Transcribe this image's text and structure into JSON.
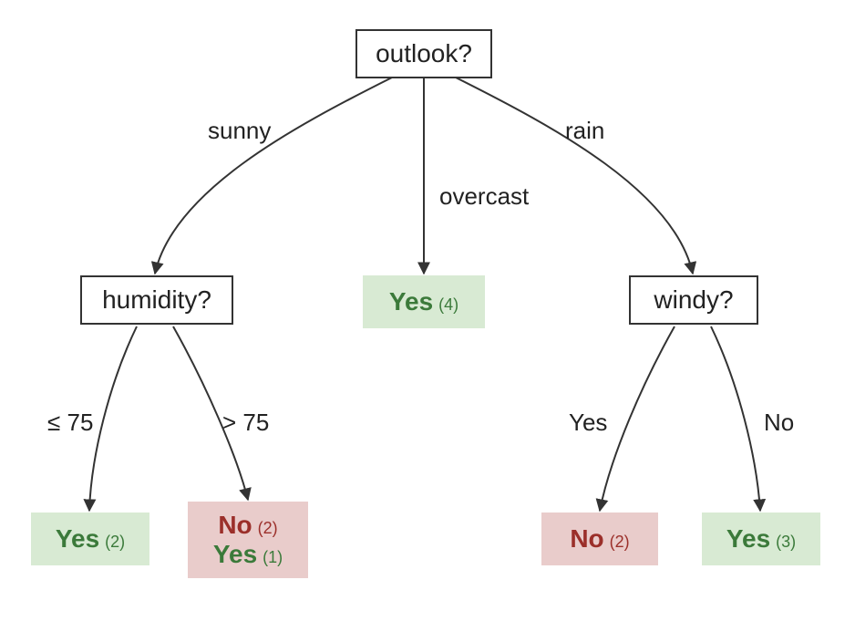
{
  "diagram": {
    "type": "decision-tree",
    "root": {
      "label": "outlook?",
      "branches": {
        "sunny": {
          "label": "sunny"
        },
        "overcast": {
          "label": "overcast"
        },
        "rain": {
          "label": "rain"
        }
      }
    },
    "humidity": {
      "label": "humidity?",
      "branches": {
        "le75": {
          "label": "≤ 75"
        },
        "gt75": {
          "label": "> 75"
        }
      }
    },
    "windy": {
      "label": "windy?",
      "branches": {
        "yes": {
          "label": "Yes"
        },
        "no": {
          "label": "No"
        }
      }
    },
    "leaves": {
      "overcast_yes": {
        "lines": [
          {
            "value": "Yes",
            "count": "(4)",
            "cls": "yes"
          }
        ],
        "bg": "yes"
      },
      "hum_le75_yes": {
        "lines": [
          {
            "value": "Yes",
            "count": "(2)",
            "cls": "yes"
          }
        ],
        "bg": "yes"
      },
      "hum_gt75_mix": {
        "lines": [
          {
            "value": "No",
            "count": "(2)",
            "cls": "no"
          },
          {
            "value": "Yes",
            "count": "(1)",
            "cls": "yes"
          }
        ],
        "bg": "no"
      },
      "windy_yes_no": {
        "lines": [
          {
            "value": "No",
            "count": "(2)",
            "cls": "no"
          }
        ],
        "bg": "no"
      },
      "windy_no_yes": {
        "lines": [
          {
            "value": "Yes",
            "count": "(3)",
            "cls": "yes"
          }
        ],
        "bg": "yes"
      }
    }
  }
}
